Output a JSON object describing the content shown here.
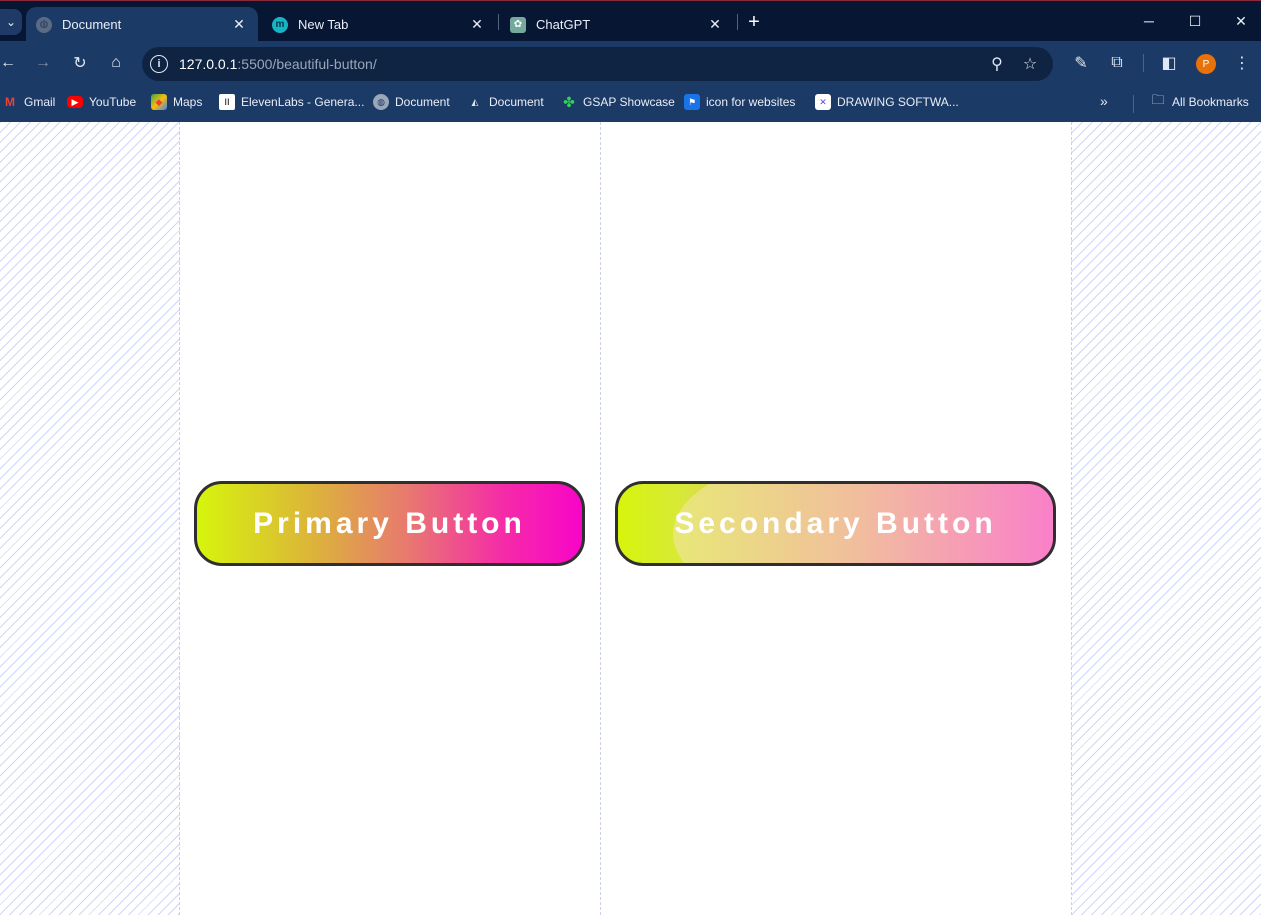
{
  "tabs": [
    {
      "label": "Document",
      "icon": "globe-icon",
      "active": true
    },
    {
      "label": "New Tab",
      "icon": "m-logo-icon",
      "active": false
    },
    {
      "label": "ChatGPT",
      "icon": "chatgpt-icon",
      "active": false
    }
  ],
  "address": {
    "host": "127.0.0.1",
    "rest": ":5500/beautiful-button/"
  },
  "profile": {
    "initial": "P",
    "color": "#e8710a"
  },
  "bookmarks": [
    {
      "label": "Gmail",
      "icon": "gmail-icon"
    },
    {
      "label": "YouTube",
      "icon": "youtube-icon"
    },
    {
      "label": "Maps",
      "icon": "maps-icon"
    },
    {
      "label": "ElevenLabs - Genera...",
      "icon": "elevenlabs-icon"
    },
    {
      "label": "Document",
      "icon": "globe-icon"
    },
    {
      "label": "Document",
      "icon": "document-icon"
    },
    {
      "label": "GSAP Showcase",
      "icon": "gsap-icon"
    },
    {
      "label": "icon for websites",
      "icon": "icon-site-icon"
    },
    {
      "label": "DRAWING SOFTWA...",
      "icon": "drawing-icon"
    }
  ],
  "all_bookmarks": "All Bookmarks",
  "buttons": {
    "primary": "Primary Button",
    "secondary": "Secondary Button"
  },
  "colors": {
    "gradient_start": "#d6f50c",
    "gradient_end": "#f805c8",
    "frame": "#1c3a66"
  }
}
